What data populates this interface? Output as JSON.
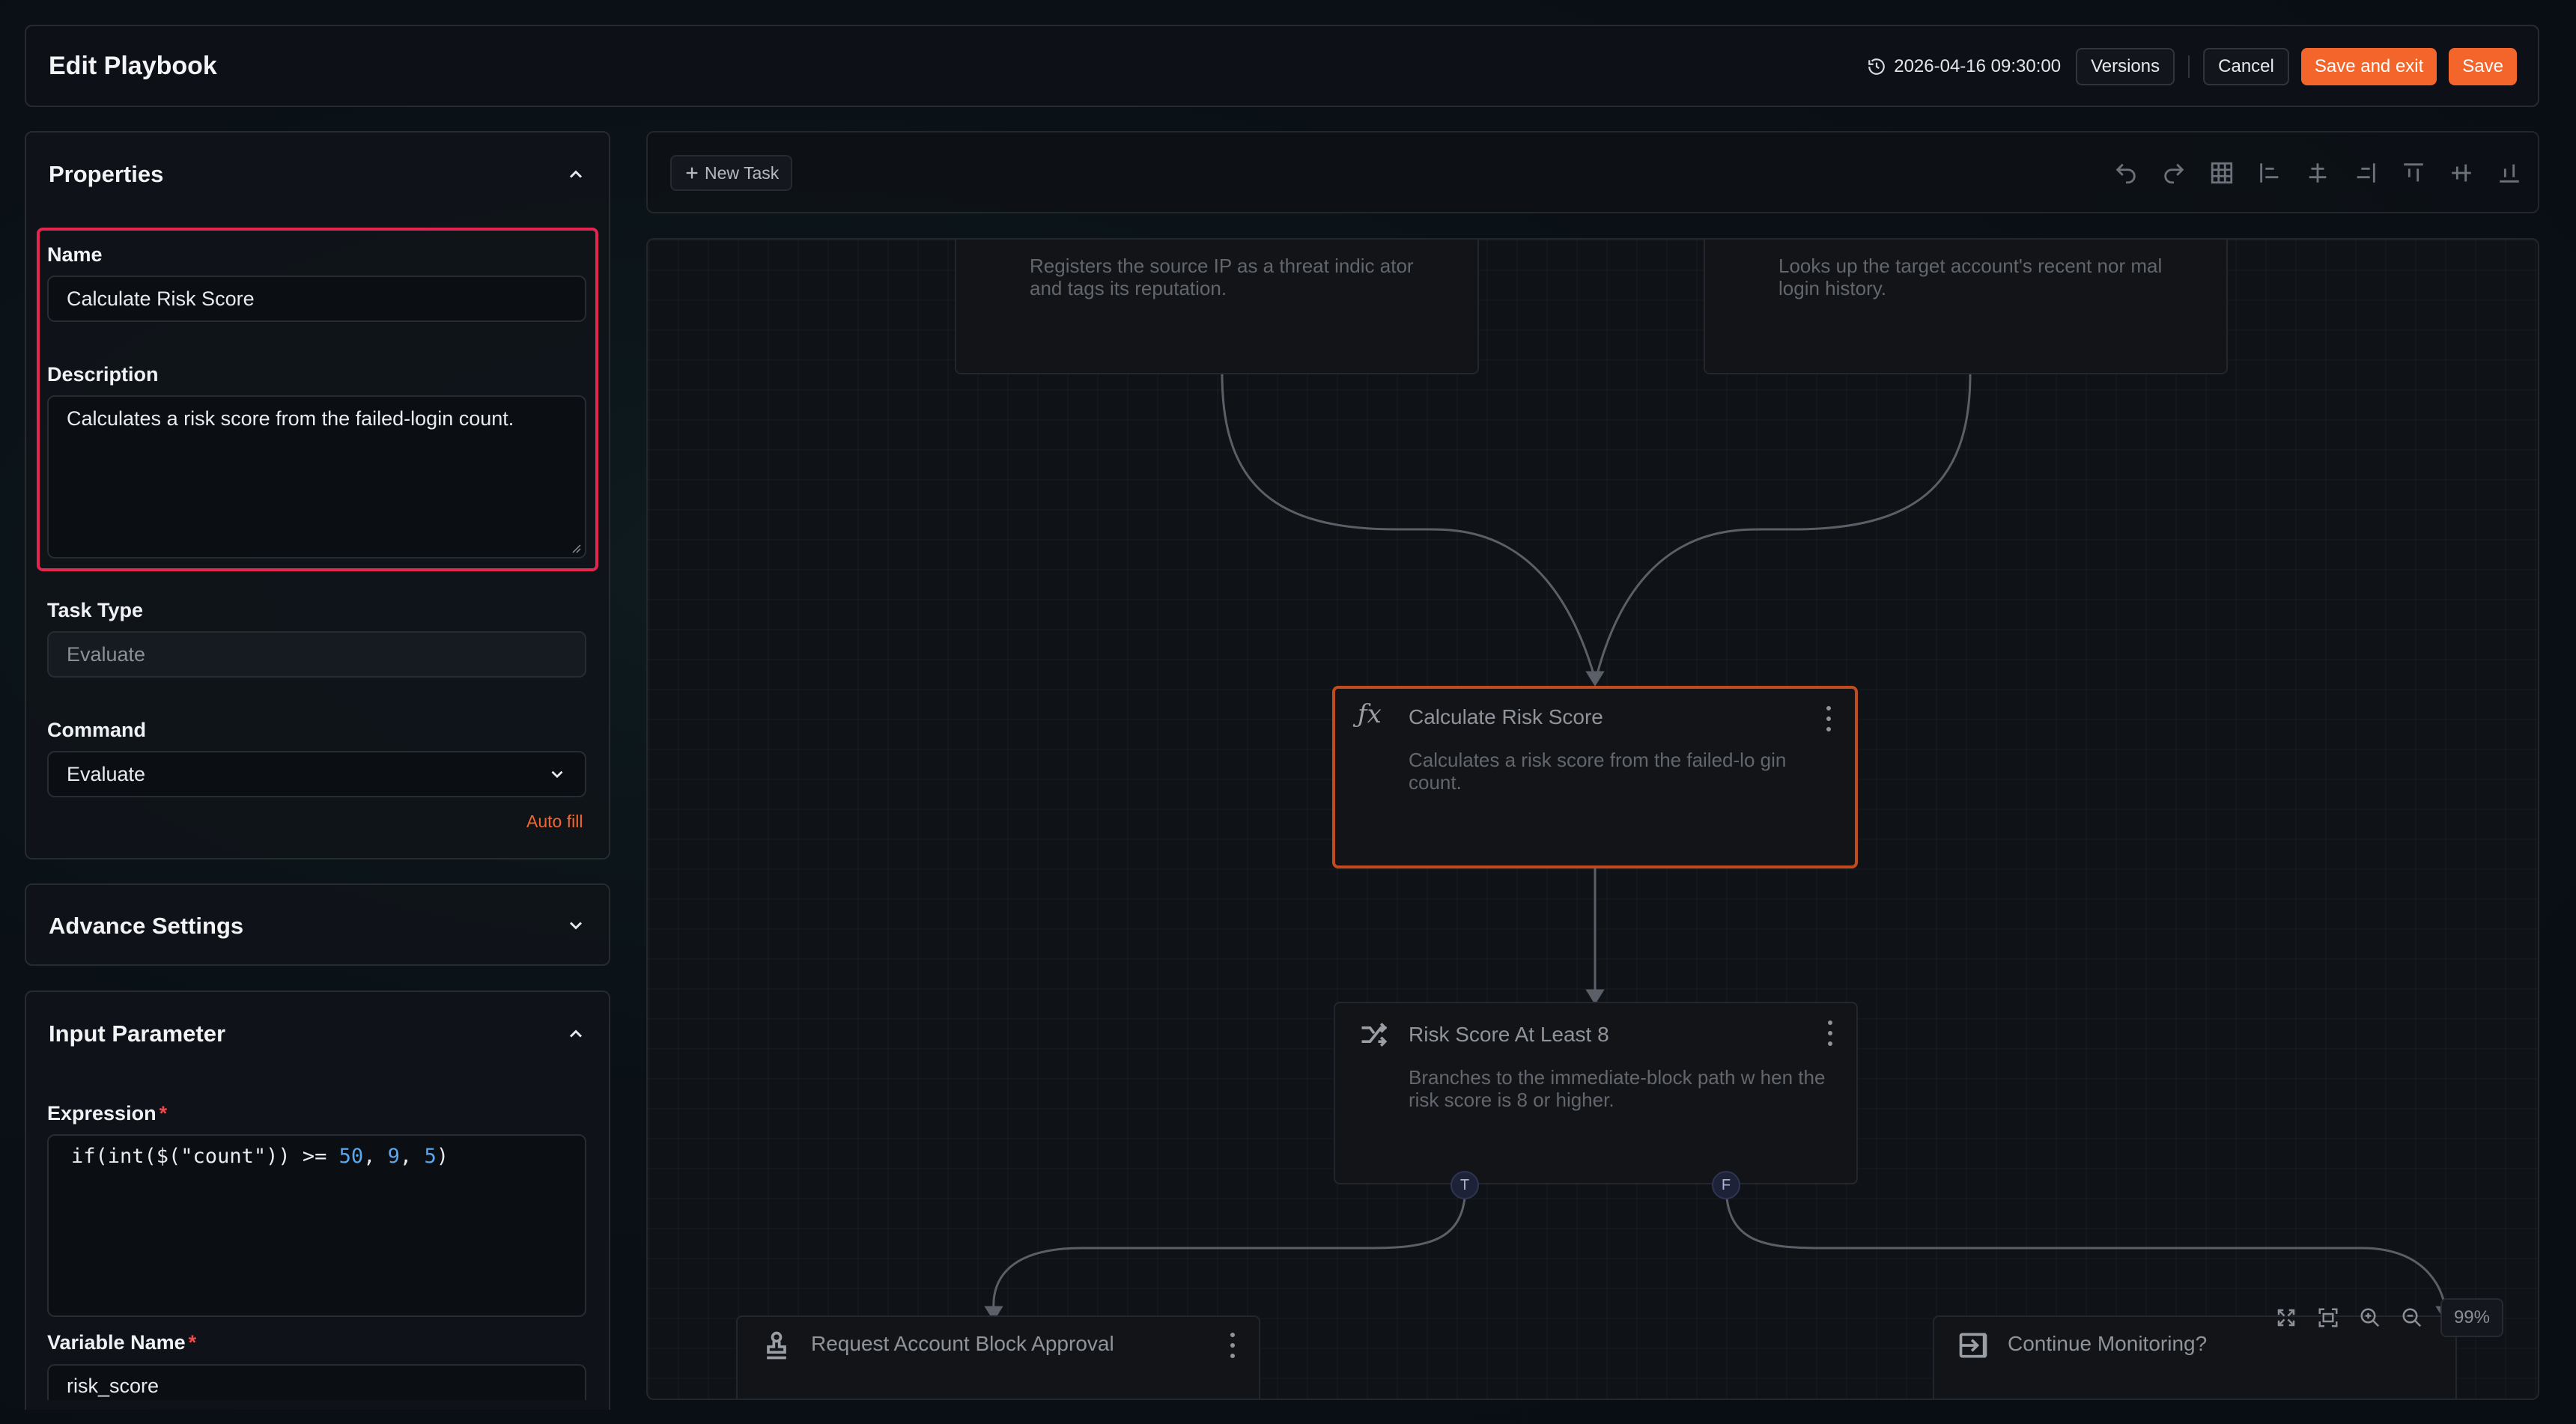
{
  "header": {
    "title": "Edit Playbook",
    "timestamp": "2026-04-16 09:30:00",
    "versions_label": "Versions",
    "cancel_label": "Cancel",
    "save_exit_label": "Save and exit",
    "save_label": "Save"
  },
  "properties": {
    "title": "Properties",
    "name_label": "Name",
    "name_value": "Calculate Risk Score",
    "description_label": "Description",
    "description_value": "Calculates a risk score from the failed-login count.",
    "task_type_label": "Task Type",
    "task_type_value": "Evaluate",
    "command_label": "Command",
    "command_value": "Evaluate",
    "auto_fill_label": "Auto fill"
  },
  "advance_settings": {
    "title": "Advance Settings"
  },
  "input_parameter": {
    "title": "Input Parameter",
    "expression_label": "Expression",
    "expression_parts": [
      "if(int($(\"count\")) >= ",
      "50",
      ", ",
      "9",
      ", ",
      "5",
      ")"
    ],
    "variable_name_label": "Variable Name",
    "variable_name_value": "risk_score"
  },
  "toolbar": {
    "new_task_label": "New Task"
  },
  "canvas": {
    "nodes": {
      "top_left_desc": "Registers the source IP as a threat indic ator and tags its reputation.",
      "top_right_desc": "Looks up the target account's recent nor mal login history.",
      "calc_title": "Calculate Risk Score",
      "calc_desc": "Calculates a risk score from the failed-lo gin count.",
      "risk_title": "Risk Score At Least 8",
      "risk_desc": "Branches to the immediate-block path w hen the risk score is 8 or higher.",
      "approval_title": "Request Account Block Approval",
      "monitor_title": "Continue Monitoring?"
    },
    "port_true": "T",
    "port_false": "F",
    "zoom": "99%"
  },
  "colors": {
    "accent": "#f3652b",
    "highlight": "#e2264f",
    "selected_node": "#c24a1f"
  }
}
